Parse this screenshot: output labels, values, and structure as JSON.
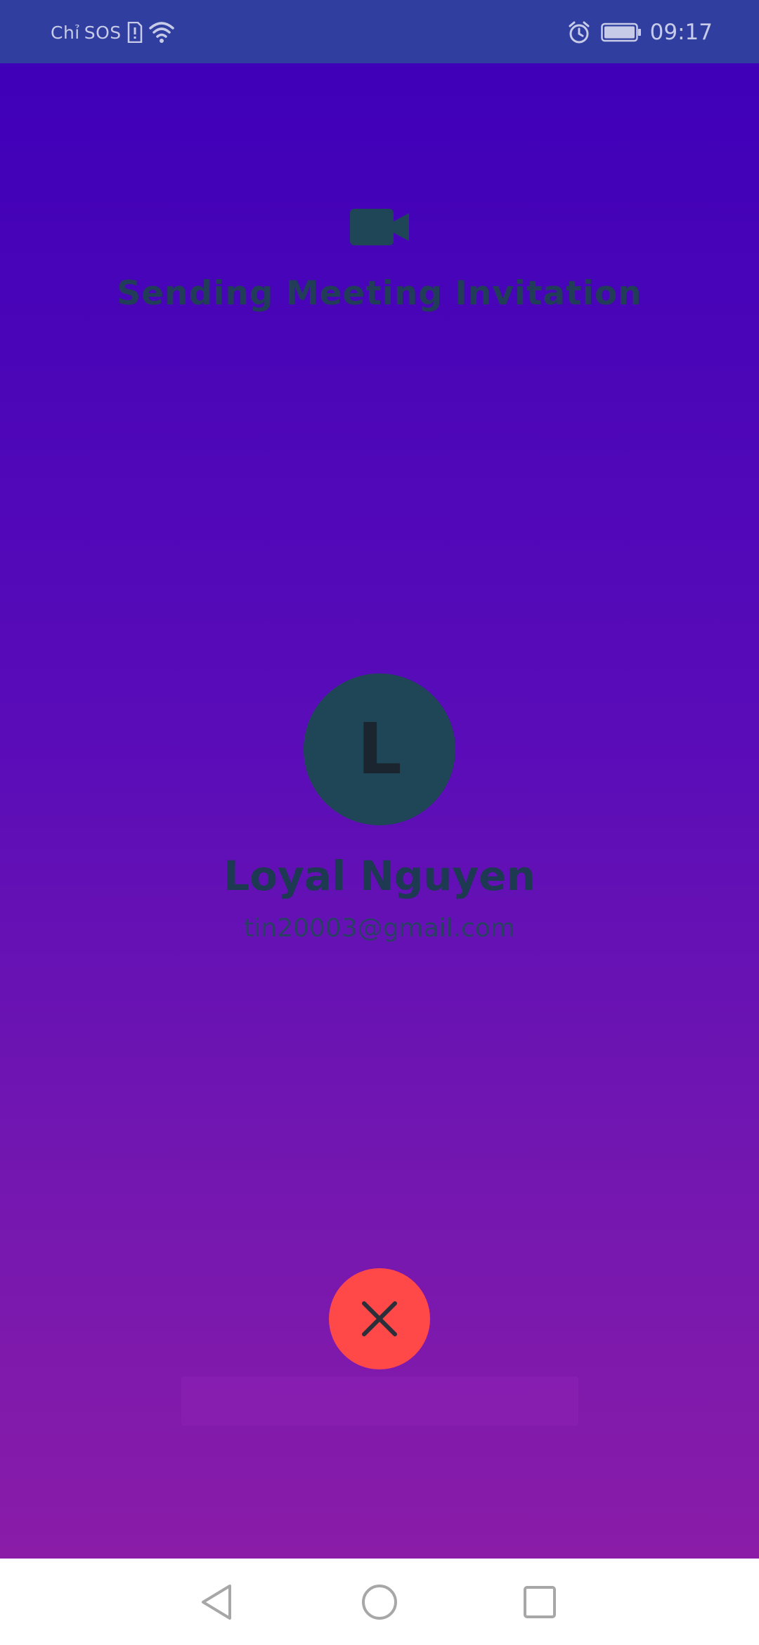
{
  "status_bar": {
    "carrier": "Chỉ",
    "sos": "SOS",
    "time": "09:17",
    "icons": [
      "sim-alert-icon",
      "wifi-icon",
      "alarm-icon",
      "battery-icon"
    ]
  },
  "header": {
    "icon": "video-camera-icon",
    "title": "Sending Meeting Invitation"
  },
  "contact": {
    "avatar_letter": "L",
    "name": "Loyal Nguyen",
    "email": "tin20003@gmail.com"
  },
  "actions": {
    "cancel_icon": "close-icon"
  },
  "nav_bar": {
    "items": [
      "back-icon",
      "home-icon",
      "recent-apps-icon"
    ]
  },
  "colors": {
    "status_bar": "#303f9f",
    "gradient_top": "#3f00b8",
    "gradient_bottom": "#8a1ca8",
    "text_dark": "#213d57",
    "avatar_bg": "#1f4656",
    "cancel_button": "#ff4848"
  }
}
